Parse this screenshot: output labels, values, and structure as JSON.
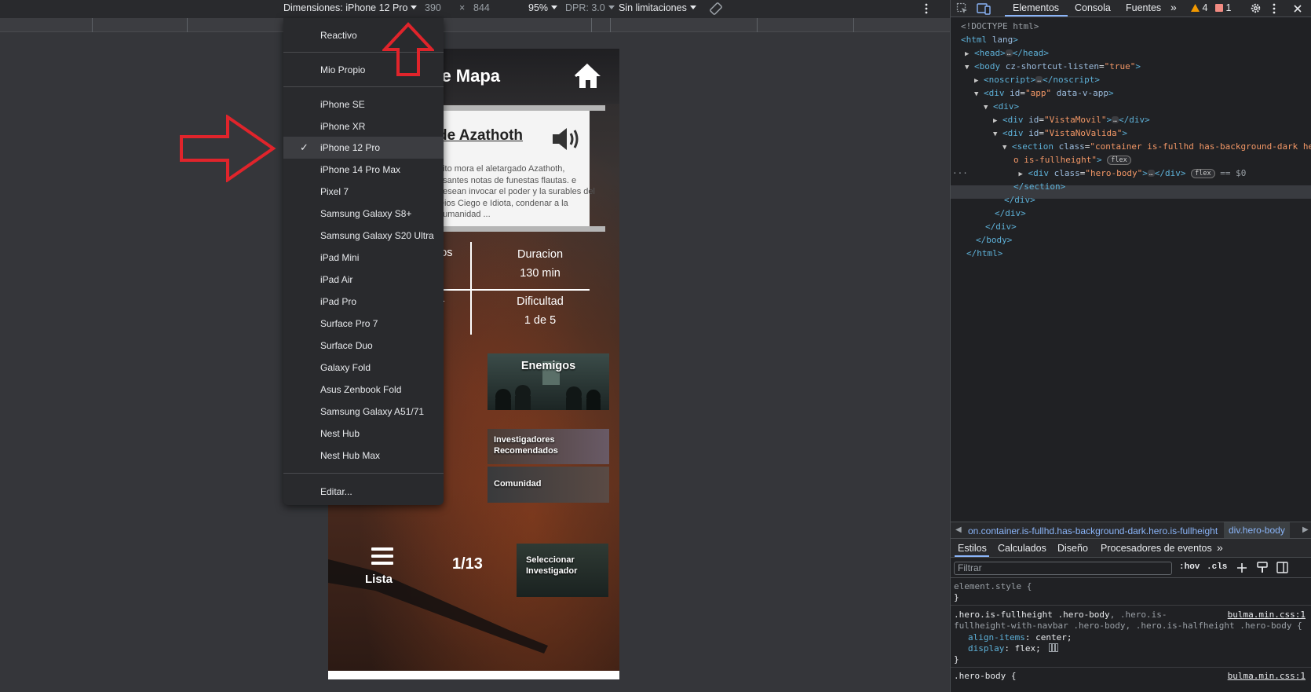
{
  "device_toolbar": {
    "dimensions_label": "Dimensiones: iPhone 12 Pro",
    "width": "390",
    "times": "×",
    "height": "844",
    "zoom": "95%",
    "dpr": "DPR: 3.0",
    "throttle": "Sin limitaciones"
  },
  "device_menu": {
    "items": [
      {
        "label": "Reactivo"
      },
      {
        "label": "Mio Propio"
      },
      {
        "label": "iPhone SE"
      },
      {
        "label": "iPhone XR"
      },
      {
        "label": "iPhone 12 Pro",
        "selected": true
      },
      {
        "label": "iPhone 14 Pro Max"
      },
      {
        "label": "Pixel 7"
      },
      {
        "label": "Samsung Galaxy S8+"
      },
      {
        "label": "Samsung Galaxy S20 Ultra"
      },
      {
        "label": "iPad Mini"
      },
      {
        "label": "iPad Air"
      },
      {
        "label": "iPad Pro"
      },
      {
        "label": "Surface Pro 7"
      },
      {
        "label": "Surface Duo"
      },
      {
        "label": "Galaxy Fold"
      },
      {
        "label": "Asus Zenbook Fold"
      },
      {
        "label": "Samsung Galaxy A51/71"
      },
      {
        "label": "Nest Hub"
      },
      {
        "label": "Nest Hub Max"
      },
      {
        "label": "Editar..."
      }
    ],
    "check_glyph": "✓"
  },
  "phone": {
    "header_title": "alle Mapa",
    "story_title": "de Azathoth",
    "story_text": "nito mora el aletargado Azathoth, esantes notas de funestas flautas. e desean invocar el poder y la surables del Dios Ciego e Idiota, condenar a la humanidad ...",
    "stat_left_top": "ios",
    "stat_left_bottom": "a",
    "stat_duration_label": "Duracion",
    "stat_duration_value": "130 min",
    "stat_difficulty_label": "Dificultad",
    "stat_difficulty_value": "1 de 5",
    "enemigos": "Enemigos",
    "investigadores_line1": "Investigadores",
    "investigadores_line2": "Recomendados",
    "comunidad": "Comunidad",
    "seleccionar_line1": "Seleccionar",
    "seleccionar_line2": "Investigador",
    "lista": "Lista",
    "page_counter": "1/13"
  },
  "devtools": {
    "tabs": [
      "Elementos",
      "Consola",
      "Fuentes"
    ],
    "more_tabs": "»",
    "warnings": "4",
    "errors": "1",
    "dom": {
      "doctype": "<!DOCTYPE html>",
      "html_open": "html",
      "html_attr": "lang",
      "head": "head",
      "body": "body",
      "body_attr": "cz-shortcut-listen",
      "body_val": "\"true\"",
      "noscript": "noscript",
      "div": "div",
      "app_attr_id": "id",
      "app_val": "\"app\"",
      "app_attr2": "data-v-app",
      "vistamovil_val": "\"VistaMovil\"",
      "vistanovalida_val": "\"VistaNoValida\"",
      "section": "section",
      "class_attr": "class",
      "section_class_val_1": "\"container is-fullhd has-background-dark her",
      "section_class_val_2": "o is-fullheight\"",
      "hero_body_val": "\"hero-body\"",
      "flex": "flex",
      "eq": "== $0",
      "ellipsis": "…",
      "row_dots": "···",
      "close_section": "</section>",
      "close_div": "</div>",
      "close_body": "</body>",
      "close_html": "</html>"
    },
    "breadcrumb": [
      "on.container.is-fullhd.has-background-dark.hero.is-fullheight",
      "div.hero-body"
    ],
    "sub_tabs": [
      "Estilos",
      "Calculados",
      "Diseño",
      "Procesadores de eventos"
    ],
    "filter_placeholder": "Filtrar",
    "hov": ":hov",
    "cls": ".cls",
    "styles": {
      "element_style": "element.style {",
      "close_brace": "}",
      "rule1_selector_a": ".hero.is-fullheight .hero-body",
      "rule1_selector_b": ", .hero.is-",
      "rule1_selector_c": "fullheight-with-navbar .hero-body, .hero.is-halfheight .hero-body {",
      "rule1_source": "bulma.min.css:1",
      "prop_align_items": "align-items",
      "val_center": "center;",
      "prop_display": "display",
      "val_flex": "flex;",
      "rule2_selector": ".hero-body {",
      "rule2_source": "bulma.min.css:1"
    }
  }
}
